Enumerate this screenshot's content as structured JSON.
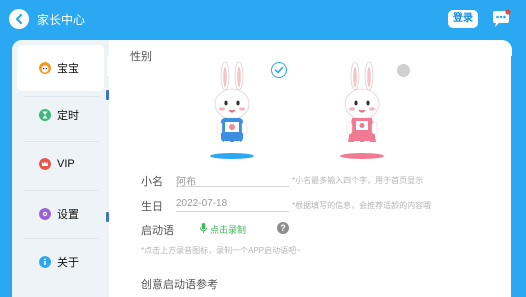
{
  "header": {
    "title": "家长中心",
    "login_label": "登录",
    "back_icon": "chevron-left-icon",
    "chat_icon": "chat-bubble-icon"
  },
  "sidebar": {
    "items": [
      {
        "label": "宝宝",
        "icon": "baby-face-icon",
        "icon_color": "#f39a1e",
        "active": true
      },
      {
        "label": "定时",
        "icon": "hourglass-icon",
        "icon_color": "#3cb97a",
        "active": false
      },
      {
        "label": "VIP",
        "icon": "crown-icon",
        "icon_color": "#e8564c",
        "active": false
      },
      {
        "label": "设置",
        "icon": "gear-icon",
        "icon_color": "#9a5fd6",
        "active": false
      },
      {
        "label": "关于",
        "icon": "info-icon",
        "icon_color": "#2aa8f2",
        "active": false
      }
    ]
  },
  "form": {
    "gender_label": "性别",
    "gender_boy_selected": true,
    "gender_girl_selected": false,
    "nickname_label": "小名",
    "nickname_value": "阿布",
    "nickname_hint": "*小名最多输入四个字，用于首页显示",
    "birthday_label": "生日",
    "birthday_value": "2022-07-18",
    "birthday_hint": "*根据填写的信息，会推荐适龄的内容哦",
    "voice_label": "启动语",
    "record_label": "点击录制",
    "record_icon": "mic-icon",
    "voice_hint": "*点击上方录音图标，录制一个APP启动语吧~",
    "creative_label": "创意启动语参考"
  },
  "colors": {
    "brand": "#2aa8f2",
    "record_green": "#3fb65a",
    "boy_outfit": "#3a8fe0",
    "girl_outfit": "#f07a92"
  }
}
